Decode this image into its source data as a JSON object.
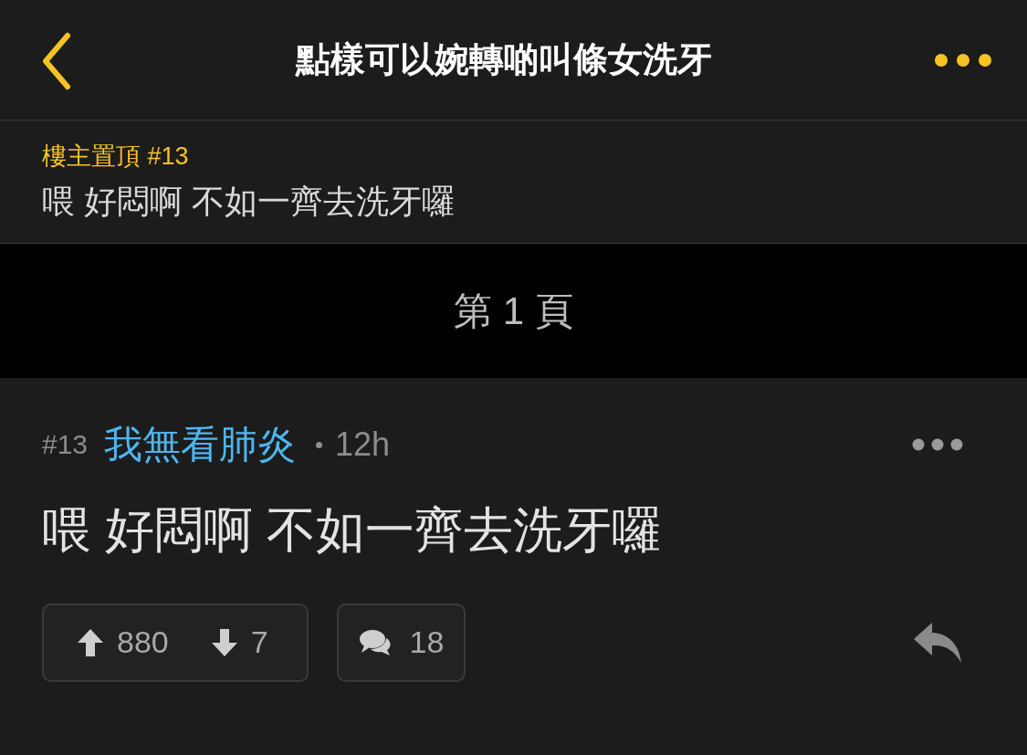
{
  "header": {
    "title": "點樣可以婉轉啲叫條女洗牙"
  },
  "pinned": {
    "label": "樓主置頂 #13",
    "text": "喂 好悶啊 不如一齊去洗牙囉"
  },
  "page_divider": {
    "label": "第 1 頁"
  },
  "post": {
    "number": "#13",
    "author": "我無看肺炎",
    "time": "12h",
    "body": "喂 好悶啊 不如一齊去洗牙囉",
    "upvotes": "880",
    "downvotes": "7",
    "comments": "18"
  }
}
